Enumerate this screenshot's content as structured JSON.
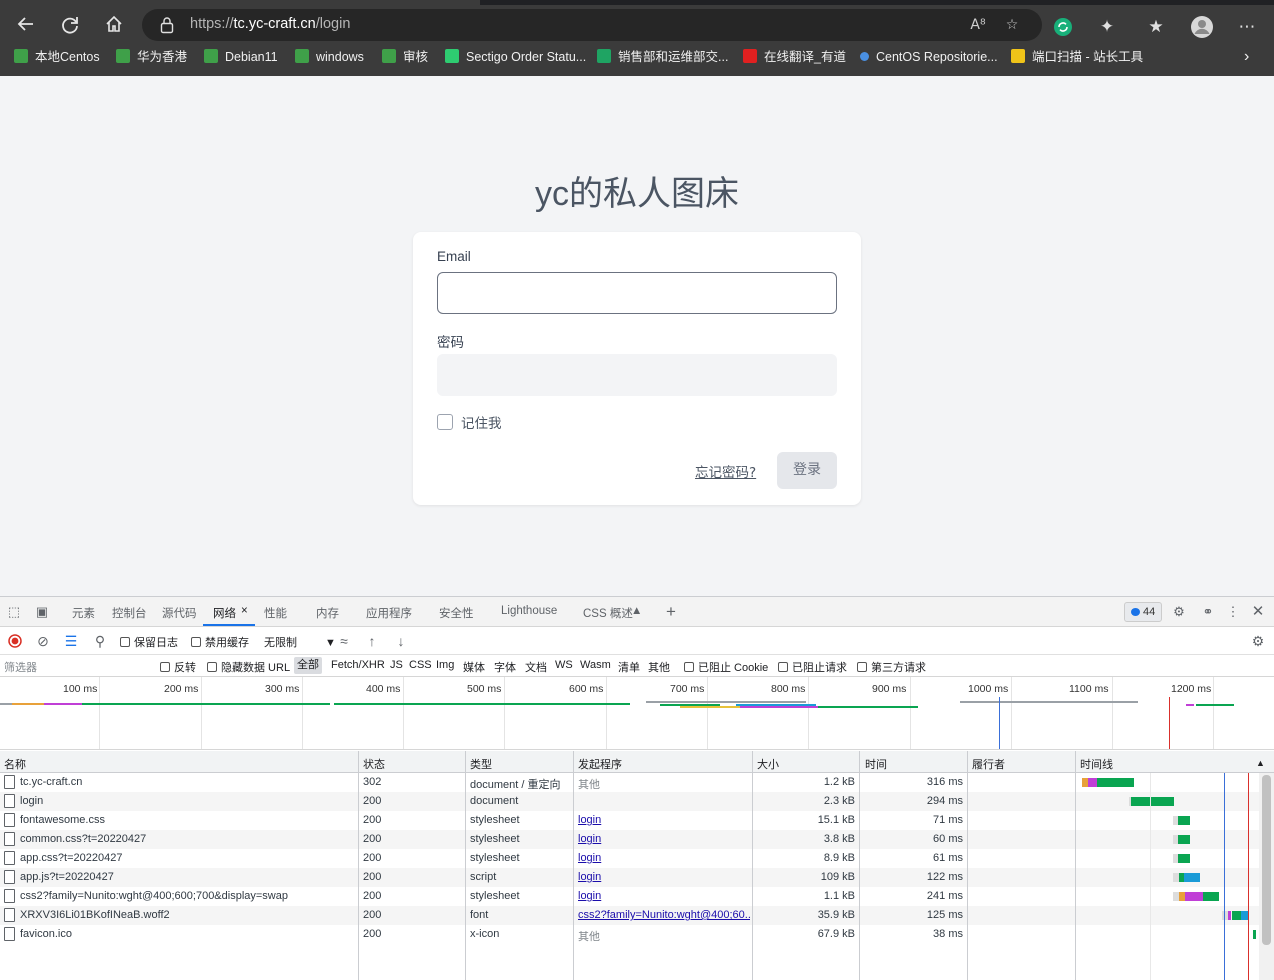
{
  "browser": {
    "url_scheme": "https://",
    "url_host": "tc.yc-craft.cn",
    "url_path": "/login",
    "bookmarks": [
      {
        "label": "本地Centos",
        "color": "#3fa049"
      },
      {
        "label": "华为香港",
        "color": "#3fa049"
      },
      {
        "label": "Debian11",
        "color": "#3fa049"
      },
      {
        "label": "windows",
        "color": "#3fa049"
      },
      {
        "label": "审核",
        "color": "#3fa049"
      },
      {
        "label": "Sectigo Order Statu...",
        "color": "#2ecc71"
      },
      {
        "label": "销售部和运维部交...",
        "color": "#1fa463"
      },
      {
        "label": "在线翻译_有道",
        "color": "#e02020"
      },
      {
        "label": "CentOS Repositorie...",
        "color": "#4a90e2"
      },
      {
        "label": "端口扫描 - 站长工具",
        "color": "#f0c419"
      }
    ]
  },
  "page": {
    "title": "yc的私人图床",
    "email_label": "Email",
    "email_value": "",
    "password_label": "密码",
    "password_value": "",
    "remember_label": "记住我",
    "remember_checked": false,
    "forgot_link": "忘记密码?",
    "login_button": "登录"
  },
  "devtools": {
    "tabs": [
      "元素",
      "控制台",
      "源代码",
      "网络",
      "性能",
      "内存",
      "应用程序",
      "安全性",
      "Lighthouse",
      "CSS 概述"
    ],
    "active_tab": "网络",
    "message_count": "44",
    "toolbar": {
      "preserve_log": "保留日志",
      "disable_cache": "禁用缓存",
      "throttling": "无限制"
    },
    "filter": {
      "placeholder": "筛选器",
      "invert": "反转",
      "hide_data_urls": "隐藏数据 URL",
      "types": [
        "全部",
        "Fetch/XHR",
        "JS",
        "CSS",
        "Img",
        "媒体",
        "字体",
        "文档",
        "WS",
        "Wasm",
        "清单",
        "其他"
      ],
      "selected_type": "全部",
      "blocked_cookies": "已阻止 Cookie",
      "blocked_requests": "已阻止请求",
      "third_party": "第三方请求"
    },
    "overview_ticks": [
      "100 ms",
      "200 ms",
      "300 ms",
      "400 ms",
      "500 ms",
      "600 ms",
      "700 ms",
      "800 ms",
      "900 ms",
      "1000 ms",
      "1100 ms",
      "1200 ms"
    ],
    "columns": [
      "名称",
      "状态",
      "类型",
      "发起程序",
      "大小",
      "时间",
      "履行者",
      "时间线"
    ],
    "requests": [
      {
        "name": "tc.yc-craft.cn",
        "status": "302",
        "type": "document / 重定向",
        "initiator": "其他",
        "initiator_link": false,
        "size": "1.2 kB",
        "time": "316 ms"
      },
      {
        "name": "login",
        "status": "200",
        "type": "document",
        "initiator": "",
        "initiator_link": false,
        "size": "2.3 kB",
        "time": "294 ms"
      },
      {
        "name": "fontawesome.css",
        "status": "200",
        "type": "stylesheet",
        "initiator": "login",
        "initiator_link": true,
        "size": "15.1 kB",
        "time": "71 ms"
      },
      {
        "name": "common.css?t=20220427",
        "status": "200",
        "type": "stylesheet",
        "initiator": "login",
        "initiator_link": true,
        "size": "3.8 kB",
        "time": "60 ms"
      },
      {
        "name": "app.css?t=20220427",
        "status": "200",
        "type": "stylesheet",
        "initiator": "login",
        "initiator_link": true,
        "size": "8.9 kB",
        "time": "61 ms"
      },
      {
        "name": "app.js?t=20220427",
        "status": "200",
        "type": "script",
        "initiator": "login",
        "initiator_link": true,
        "size": "109 kB",
        "time": "122 ms"
      },
      {
        "name": "css2?family=Nunito:wght@400;600;700&display=swap",
        "status": "200",
        "type": "stylesheet",
        "initiator": "login",
        "initiator_link": true,
        "size": "1.1 kB",
        "time": "241 ms"
      },
      {
        "name": "XRXV3I6Li01BKofINeaB.woff2",
        "status": "200",
        "type": "font",
        "initiator": "css2?family=Nunito:wght@400;60...",
        "initiator_link": true,
        "size": "35.9 kB",
        "time": "125 ms"
      },
      {
        "name": "favicon.ico",
        "status": "200",
        "type": "x-icon",
        "initiator": "其他",
        "initiator_link": false,
        "size": "67.9 kB",
        "time": "38 ms"
      }
    ]
  },
  "colors": {
    "waterfall_green": "#0aa551",
    "waterfall_blue": "#1a9bd7",
    "waterfall_orange": "#e8a13a",
    "waterfall_purple": "#c03fd6",
    "dom_content_line": "#3a6fd8",
    "load_line": "#d9302c"
  }
}
